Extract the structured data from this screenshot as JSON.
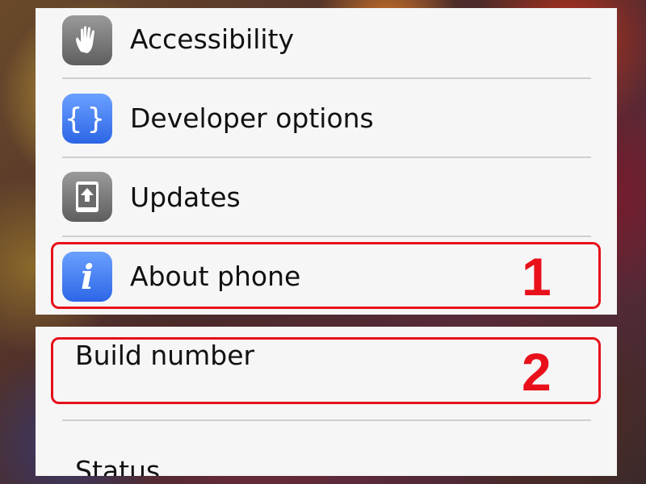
{
  "settings_menu": {
    "items": [
      {
        "label": "Accessibility",
        "icon": "hand-icon"
      },
      {
        "label": "Developer options",
        "icon": "braces-icon"
      },
      {
        "label": "Updates",
        "icon": "update-icon"
      },
      {
        "label": "About phone",
        "icon": "info-icon"
      }
    ]
  },
  "about_phone": {
    "items": [
      {
        "label": "Build number"
      },
      {
        "label": "Status"
      }
    ]
  },
  "annotations": {
    "step1": "1",
    "step2": "2",
    "color": "#e8101a"
  }
}
